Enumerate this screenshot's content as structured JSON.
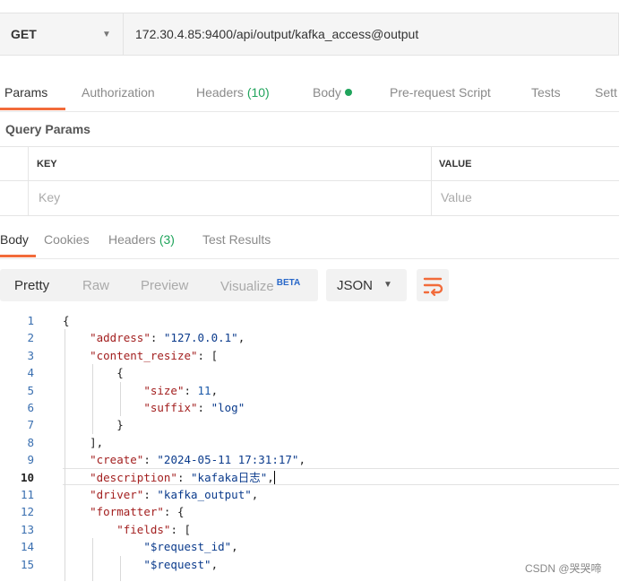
{
  "request": {
    "method": "GET",
    "url": "172.30.4.85:9400/api/output/kafka_access@output"
  },
  "request_tabs": {
    "params": "Params",
    "authorization": "Authorization",
    "headers": "Headers",
    "headers_count": "(10)",
    "body": "Body",
    "pre_request": "Pre-request Script",
    "tests": "Tests",
    "settings": "Sett"
  },
  "query_params": {
    "title": "Query Params",
    "key_header": "KEY",
    "value_header": "VALUE",
    "key_placeholder": "Key",
    "value_placeholder": "Value"
  },
  "response_tabs": {
    "body": "Body",
    "cookies": "Cookies",
    "headers": "Headers",
    "headers_count": "(3)",
    "test_results": "Test Results"
  },
  "view_modes": {
    "pretty": "Pretty",
    "raw": "Raw",
    "preview": "Preview",
    "visualize": "Visualize",
    "beta": "BETA",
    "format": "JSON"
  },
  "code": {
    "line_numbers": [
      "1",
      "2",
      "3",
      "4",
      "5",
      "6",
      "7",
      "8",
      "9",
      "10",
      "11",
      "12",
      "13",
      "14",
      "15"
    ],
    "current_line": "10",
    "address_key": "\"address\"",
    "address_val": "\"127.0.0.1\"",
    "content_resize_key": "\"content_resize\"",
    "size_key": "\"size\"",
    "size_val": "11",
    "suffix_key": "\"suffix\"",
    "suffix_val": "\"log\"",
    "create_key": "\"create\"",
    "create_val": "\"2024-05-11 17:31:17\"",
    "description_key": "\"description\"",
    "description_val": "\"kafaka日志\"",
    "driver_key": "\"driver\"",
    "driver_val": "\"kafka_output\"",
    "formatter_key": "\"formatter\"",
    "fields_key": "\"fields\"",
    "field1": "\"$request_id\"",
    "field2": "\"$request\""
  },
  "watermark": "CSDN @哭哭啼",
  "colors": {
    "accent": "#f26b3a",
    "green": "#20a45c"
  }
}
